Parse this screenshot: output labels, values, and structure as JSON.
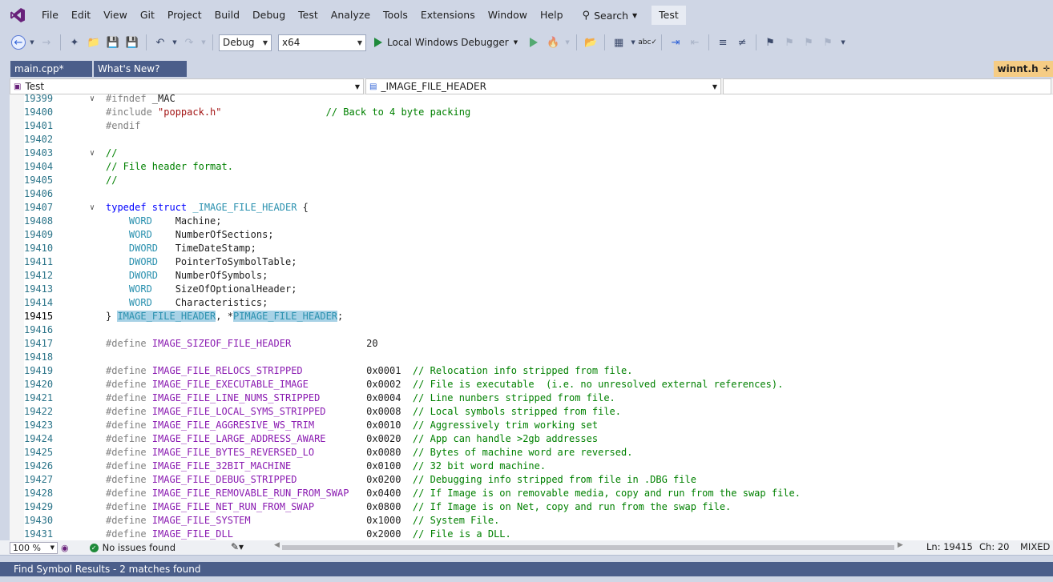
{
  "menubar": {
    "items": [
      "File",
      "Edit",
      "View",
      "Git",
      "Project",
      "Build",
      "Debug",
      "Test",
      "Analyze",
      "Tools",
      "Extensions",
      "Window",
      "Help"
    ],
    "search_label": "Search",
    "solution_name": "Test"
  },
  "toolbar": {
    "config": "Debug",
    "platform": "x64",
    "run_label": "Local Windows Debugger"
  },
  "tabs": {
    "left": [
      "main.cpp*",
      "What's New?"
    ],
    "active": "winnt.h"
  },
  "navbar": {
    "project": "Test",
    "symbol": "_IMAGE_FILE_HEADER"
  },
  "editor": {
    "lines": [
      {
        "n": "19399",
        "fold": "v",
        "code": [
          [
            "pp",
            "#ifndef"
          ],
          [
            "id",
            " _MAC"
          ]
        ]
      },
      {
        "n": "19400",
        "code": [
          [
            "pp",
            "#include "
          ],
          [
            "str",
            "\"poppack.h\""
          ],
          [
            "id",
            "                  "
          ],
          [
            "cm",
            "// Back to 4 byte packing"
          ]
        ]
      },
      {
        "n": "19401",
        "code": [
          [
            "pp",
            "#endif"
          ]
        ]
      },
      {
        "n": "19402",
        "code": []
      },
      {
        "n": "19403",
        "fold": "v",
        "code": [
          [
            "cm",
            "//"
          ]
        ]
      },
      {
        "n": "19404",
        "code": [
          [
            "cm",
            "// File header format."
          ]
        ]
      },
      {
        "n": "19405",
        "code": [
          [
            "cm",
            "//"
          ]
        ]
      },
      {
        "n": "19406",
        "code": []
      },
      {
        "n": "19407",
        "fold": "v",
        "code": [
          [
            "kw",
            "typedef struct "
          ],
          [
            "ty",
            "_IMAGE_FILE_HEADER"
          ],
          [
            "id",
            " {"
          ]
        ]
      },
      {
        "n": "19408",
        "code": [
          [
            "id",
            "    "
          ],
          [
            "ty",
            "WORD"
          ],
          [
            "id",
            "    Machine;"
          ]
        ]
      },
      {
        "n": "19409",
        "code": [
          [
            "id",
            "    "
          ],
          [
            "ty",
            "WORD"
          ],
          [
            "id",
            "    NumberOfSections;"
          ]
        ]
      },
      {
        "n": "19410",
        "code": [
          [
            "id",
            "    "
          ],
          [
            "ty",
            "DWORD"
          ],
          [
            "id",
            "   TimeDateStamp;"
          ]
        ]
      },
      {
        "n": "19411",
        "code": [
          [
            "id",
            "    "
          ],
          [
            "ty",
            "DWORD"
          ],
          [
            "id",
            "   PointerToSymbolTable;"
          ]
        ]
      },
      {
        "n": "19412",
        "code": [
          [
            "id",
            "    "
          ],
          [
            "ty",
            "DWORD"
          ],
          [
            "id",
            "   NumberOfSymbols;"
          ]
        ]
      },
      {
        "n": "19413",
        "code": [
          [
            "id",
            "    "
          ],
          [
            "ty",
            "WORD"
          ],
          [
            "id",
            "    SizeOfOptionalHeader;"
          ]
        ]
      },
      {
        "n": "19414",
        "code": [
          [
            "id",
            "    "
          ],
          [
            "ty",
            "WORD"
          ],
          [
            "id",
            "    Characteristics;"
          ]
        ]
      },
      {
        "n": "19415",
        "current": true,
        "code": [
          [
            "id",
            "} "
          ],
          [
            "tyhl",
            "IMAGE_FILE_HEADER"
          ],
          [
            "id",
            ", *"
          ],
          [
            "tyl",
            "PIMAGE_FILE_HEADER"
          ],
          [
            "id",
            ";"
          ]
        ]
      },
      {
        "n": "19416",
        "code": []
      },
      {
        "n": "19417",
        "code": [
          [
            "pp",
            "#define "
          ],
          [
            "mac",
            "IMAGE_SIZEOF_FILE_HEADER"
          ],
          [
            "id",
            "             20"
          ]
        ]
      },
      {
        "n": "19418",
        "code": []
      },
      {
        "n": "19419",
        "code": [
          [
            "pp",
            "#define "
          ],
          [
            "mac",
            "IMAGE_FILE_RELOCS_STRIPPED"
          ],
          [
            "id",
            "           0x0001  "
          ],
          [
            "cm",
            "// Relocation info stripped from file."
          ]
        ]
      },
      {
        "n": "19420",
        "code": [
          [
            "pp",
            "#define "
          ],
          [
            "mac",
            "IMAGE_FILE_EXECUTABLE_IMAGE"
          ],
          [
            "id",
            "          0x0002  "
          ],
          [
            "cm",
            "// File is executable  (i.e. no unresolved external references)."
          ]
        ]
      },
      {
        "n": "19421",
        "code": [
          [
            "pp",
            "#define "
          ],
          [
            "mac",
            "IMAGE_FILE_LINE_NUMS_STRIPPED"
          ],
          [
            "id",
            "        0x0004  "
          ],
          [
            "cm",
            "// Line nunbers stripped from file."
          ]
        ]
      },
      {
        "n": "19422",
        "code": [
          [
            "pp",
            "#define "
          ],
          [
            "mac",
            "IMAGE_FILE_LOCAL_SYMS_STRIPPED"
          ],
          [
            "id",
            "       0x0008  "
          ],
          [
            "cm",
            "// Local symbols stripped from file."
          ]
        ]
      },
      {
        "n": "19423",
        "code": [
          [
            "pp",
            "#define "
          ],
          [
            "mac",
            "IMAGE_FILE_AGGRESIVE_WS_TRIM"
          ],
          [
            "id",
            "         0x0010  "
          ],
          [
            "cm",
            "// Aggressively trim working set"
          ]
        ]
      },
      {
        "n": "19424",
        "code": [
          [
            "pp",
            "#define "
          ],
          [
            "mac",
            "IMAGE_FILE_LARGE_ADDRESS_AWARE"
          ],
          [
            "id",
            "       0x0020  "
          ],
          [
            "cm",
            "// App can handle >2gb addresses"
          ]
        ]
      },
      {
        "n": "19425",
        "code": [
          [
            "pp",
            "#define "
          ],
          [
            "mac",
            "IMAGE_FILE_BYTES_REVERSED_LO"
          ],
          [
            "id",
            "         0x0080  "
          ],
          [
            "cm",
            "// Bytes of machine word are reversed."
          ]
        ]
      },
      {
        "n": "19426",
        "code": [
          [
            "pp",
            "#define "
          ],
          [
            "mac",
            "IMAGE_FILE_32BIT_MACHINE"
          ],
          [
            "id",
            "             0x0100  "
          ],
          [
            "cm",
            "// 32 bit word machine."
          ]
        ]
      },
      {
        "n": "19427",
        "code": [
          [
            "pp",
            "#define "
          ],
          [
            "mac",
            "IMAGE_FILE_DEBUG_STRIPPED"
          ],
          [
            "id",
            "            0x0200  "
          ],
          [
            "cm",
            "// Debugging info stripped from file in .DBG file"
          ]
        ]
      },
      {
        "n": "19428",
        "code": [
          [
            "pp",
            "#define "
          ],
          [
            "mac",
            "IMAGE_FILE_REMOVABLE_RUN_FROM_SWAP"
          ],
          [
            "id",
            "   0x0400  "
          ],
          [
            "cm",
            "// If Image is on removable media, copy and run from the swap file."
          ]
        ]
      },
      {
        "n": "19429",
        "code": [
          [
            "pp",
            "#define "
          ],
          [
            "mac",
            "IMAGE_FILE_NET_RUN_FROM_SWAP"
          ],
          [
            "id",
            "         0x0800  "
          ],
          [
            "cm",
            "// If Image is on Net, copy and run from the swap file."
          ]
        ]
      },
      {
        "n": "19430",
        "code": [
          [
            "pp",
            "#define "
          ],
          [
            "mac",
            "IMAGE_FILE_SYSTEM"
          ],
          [
            "id",
            "                    0x1000  "
          ],
          [
            "cm",
            "// System File."
          ]
        ]
      },
      {
        "n": "19431",
        "code": [
          [
            "pp",
            "#define "
          ],
          [
            "mac",
            "IMAGE_FILE_DLL"
          ],
          [
            "id",
            "                       0x2000  "
          ],
          [
            "cm",
            "// File is a DLL."
          ]
        ]
      }
    ]
  },
  "status": {
    "zoom": "100 %",
    "issues": "No issues found",
    "line": "Ln: 19415",
    "col": "Ch: 20",
    "eol": "MIXED"
  },
  "bottom": {
    "find_results": "Find Symbol Results - 2 matches found"
  },
  "colors": {
    "accent": "#4b5e8a",
    "active_tab": "#f5cc84",
    "chrome": "#cfd6e5"
  }
}
